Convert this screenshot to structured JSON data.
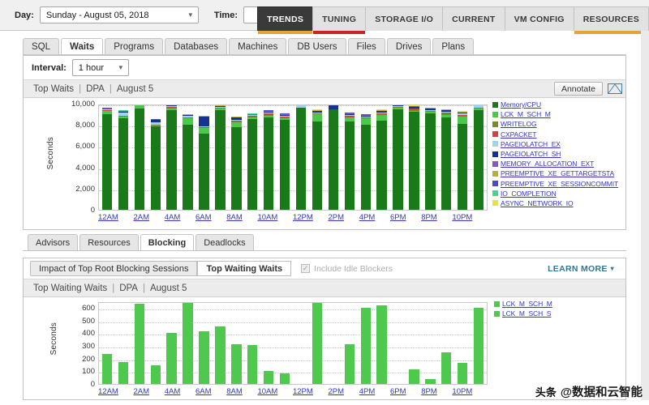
{
  "topbar": {
    "day_label": "Day:",
    "day_value": "Sunday - August 05, 2018",
    "time_label": "Time:",
    "time_value": "",
    "nav_tabs": [
      {
        "label": "TRENDS",
        "active": true,
        "underline": "#e2a33c"
      },
      {
        "label": "TUNING",
        "active": false,
        "underline": "#cc2222"
      },
      {
        "label": "STORAGE I/O",
        "active": false,
        "underline": ""
      },
      {
        "label": "CURRENT",
        "active": false,
        "underline": ""
      },
      {
        "label": "VM CONFIG",
        "active": false,
        "underline": ""
      },
      {
        "label": "RESOURCES",
        "active": false,
        "underline": "#e2a33c"
      }
    ]
  },
  "subtabs": [
    {
      "label": "SQL",
      "active": false
    },
    {
      "label": "Waits",
      "active": true
    },
    {
      "label": "Programs",
      "active": false
    },
    {
      "label": "Databases",
      "active": false
    },
    {
      "label": "Machines",
      "active": false
    },
    {
      "label": "DB Users",
      "active": false
    },
    {
      "label": "Files",
      "active": false
    },
    {
      "label": "Drives",
      "active": false
    },
    {
      "label": "Plans",
      "active": false
    }
  ],
  "top_panel": {
    "interval_label": "Interval:",
    "interval_value": "1 hour",
    "title_part1": "Top Waits",
    "title_part2": "DPA",
    "title_part3": "August 5",
    "sep": "|",
    "annotate_label": "Annotate",
    "envelope_icon": "envelope-icon"
  },
  "mid_tabs": [
    {
      "label": "Advisors",
      "active": false
    },
    {
      "label": "Resources",
      "active": false
    },
    {
      "label": "Blocking",
      "active": true
    },
    {
      "label": "Deadlocks",
      "active": false
    }
  ],
  "bottom_panel": {
    "seg_left_label": "Impact of Top Root Blocking Sessions",
    "seg_right_label": "Top Waiting Waits",
    "checkbox_label": "Include Idle Blockers",
    "checkbox_checked": true,
    "checkbox_glyph": "✓",
    "learn_more_label": "LEARN MORE",
    "learn_more_caret": "▾",
    "title_part1": "Top Waiting Waits",
    "title_part2": "DPA",
    "title_part3": "August 5",
    "sep": "|"
  },
  "watermark": {
    "badge": "头条",
    "text": "@数据和云智能"
  },
  "chart_data": [
    {
      "type": "bar",
      "stacked": true,
      "title": "Top Waits",
      "xlabel": "",
      "ylabel": "Seconds",
      "ylim": [
        0,
        10000
      ],
      "yticks": [
        0,
        2000,
        4000,
        6000,
        8000,
        10000
      ],
      "ytick_labels": [
        "0",
        "2,000",
        "4,000",
        "6,000",
        "8,000",
        "10,000"
      ],
      "grid": true,
      "legend_position": "right",
      "x": [
        "12AM",
        "1AM",
        "2AM",
        "3AM",
        "4AM",
        "5AM",
        "6AM",
        "7AM",
        "8AM",
        "9AM",
        "10AM",
        "11AM",
        "12PM",
        "1PM",
        "2PM",
        "3PM",
        "4PM",
        "5PM",
        "6PM",
        "7PM",
        "8PM",
        "9PM",
        "10PM",
        "11PM"
      ],
      "xtick_labels": [
        "12AM",
        "",
        "2AM",
        "",
        "4AM",
        "",
        "6AM",
        "",
        "8AM",
        "",
        "10AM",
        "",
        "12PM",
        "",
        "2PM",
        "",
        "4PM",
        "",
        "6PM",
        "",
        "8PM",
        "",
        "10PM",
        ""
      ],
      "series": [
        {
          "name": "Memory/CPU",
          "color": "#1a7a1a",
          "values": [
            9000,
            8650,
            9550,
            7900,
            9400,
            8050,
            7200,
            9400,
            7750,
            8550,
            8700,
            8500,
            9650,
            8300,
            9450,
            8300,
            8050,
            8400,
            9500,
            9200,
            9100,
            8700,
            8100,
            9400
          ]
        },
        {
          "name": "LCK_M_SCH_M",
          "color": "#4bc94b",
          "values": [
            280,
            140,
            420,
            60,
            140,
            560,
            480,
            150,
            520,
            120,
            150,
            140,
            0,
            700,
            0,
            380,
            540,
            560,
            110,
            140,
            140,
            260,
            660,
            130
          ]
        },
        {
          "name": "WRITELOG",
          "color": "#7a8a2a",
          "values": [
            60,
            50,
            60,
            30,
            60,
            60,
            50,
            60,
            60,
            110,
            120,
            60,
            0,
            60,
            0,
            60,
            60,
            60,
            60,
            60,
            60,
            110,
            60,
            60
          ]
        },
        {
          "name": "CXPACKET",
          "color": "#cc4444",
          "values": [
            50,
            40,
            50,
            20,
            90,
            60,
            70,
            50,
            90,
            60,
            110,
            60,
            0,
            60,
            0,
            110,
            60,
            60,
            50,
            110,
            50,
            110,
            110,
            50
          ]
        },
        {
          "name": "PAGEIOLATCH_EX",
          "color": "#9fd4ef",
          "values": [
            70,
            320,
            70,
            240,
            80,
            120,
            60,
            60,
            70,
            60,
            70,
            70,
            480,
            70,
            0,
            70,
            70,
            120,
            60,
            70,
            60,
            70,
            120,
            380
          ]
        },
        {
          "name": "PAGEIOLATCH_SH",
          "color": "#16338f",
          "values": [
            40,
            70,
            40,
            220,
            180,
            70,
            900,
            40,
            200,
            40,
            120,
            130,
            0,
            120,
            600,
            120,
            110,
            110,
            120,
            120,
            120,
            120,
            110,
            60
          ]
        },
        {
          "name": "MEMORY_ALLOCATION_EXT",
          "color": "#8855cc",
          "values": [
            40,
            30,
            40,
            20,
            40,
            40,
            40,
            40,
            40,
            40,
            40,
            40,
            0,
            40,
            0,
            40,
            40,
            40,
            40,
            40,
            40,
            40,
            40,
            40
          ]
        },
        {
          "name": "PREEMPTIVE_XE_GETTARGETSTA",
          "color": "#b5b234",
          "values": [
            30,
            25,
            30,
            15,
            30,
            30,
            30,
            30,
            30,
            30,
            30,
            30,
            0,
            30,
            0,
            30,
            30,
            30,
            30,
            30,
            30,
            30,
            30,
            30
          ]
        },
        {
          "name": "PREEMPTIVE_XE_SESSIONCOMMIT",
          "color": "#4a4acd",
          "values": [
            25,
            20,
            25,
            15,
            25,
            25,
            25,
            25,
            25,
            25,
            25,
            25,
            0,
            25,
            0,
            25,
            25,
            25,
            25,
            25,
            25,
            25,
            25,
            25
          ]
        },
        {
          "name": "IO_COMPLETION",
          "color": "#48d38f",
          "values": [
            20,
            15,
            20,
            10,
            20,
            20,
            20,
            20,
            20,
            20,
            20,
            20,
            0,
            20,
            0,
            20,
            20,
            20,
            20,
            20,
            20,
            20,
            20,
            20
          ]
        },
        {
          "name": "ASYNC_NETWORK_IO",
          "color": "#e8e23a",
          "values": [
            15,
            10,
            15,
            10,
            15,
            15,
            15,
            15,
            15,
            15,
            15,
            15,
            0,
            15,
            0,
            15,
            15,
            15,
            15,
            15,
            15,
            15,
            15,
            15
          ]
        }
      ]
    },
    {
      "type": "bar",
      "stacked": false,
      "title": "Top Waiting Waits",
      "xlabel": "",
      "ylabel": "Seconds",
      "ylim": [
        0,
        650
      ],
      "yticks": [
        0,
        100,
        200,
        300,
        400,
        500,
        600
      ],
      "ytick_labels": [
        "0",
        "100",
        "200",
        "300",
        "400",
        "500",
        "600"
      ],
      "grid": true,
      "legend_position": "right",
      "x": [
        "12AM",
        "1AM",
        "2AM",
        "3AM",
        "4AM",
        "5AM",
        "6AM",
        "7AM",
        "8AM",
        "9AM",
        "10AM",
        "11AM",
        "12PM",
        "1PM",
        "2PM",
        "3PM",
        "4PM",
        "5PM",
        "6PM",
        "7PM",
        "8PM",
        "9PM",
        "10PM",
        "11PM"
      ],
      "xtick_labels": [
        "12AM",
        "",
        "2AM",
        "",
        "4AM",
        "",
        "6AM",
        "",
        "8AM",
        "",
        "10AM",
        "",
        "12PM",
        "",
        "2PM",
        "",
        "4PM",
        "",
        "6PM",
        "",
        "8PM",
        "",
        "10PM",
        ""
      ],
      "series": [
        {
          "name": "LCK_M_SCH_M",
          "color": "#4ec94e",
          "values": [
            235,
            170,
            630,
            145,
            400,
            635,
            415,
            455,
            310,
            305,
            100,
            80,
            0,
            640,
            0,
            310,
            600,
            620,
            0,
            115,
            40,
            250,
            165,
            600
          ]
        },
        {
          "name": "LCK_M_SCH_S",
          "color": "#4ec94e",
          "values": [
            0,
            0,
            0,
            0,
            0,
            0,
            0,
            0,
            0,
            0,
            0,
            0,
            0,
            0,
            0,
            0,
            0,
            0,
            0,
            0,
            0,
            0,
            0,
            0
          ]
        }
      ],
      "legend_entries": [
        {
          "name": "LCK_M_SCH_M",
          "color": "#4ec94e"
        },
        {
          "name": "LCK_M_SCH_S",
          "color": "#4ec94e"
        }
      ]
    }
  ]
}
